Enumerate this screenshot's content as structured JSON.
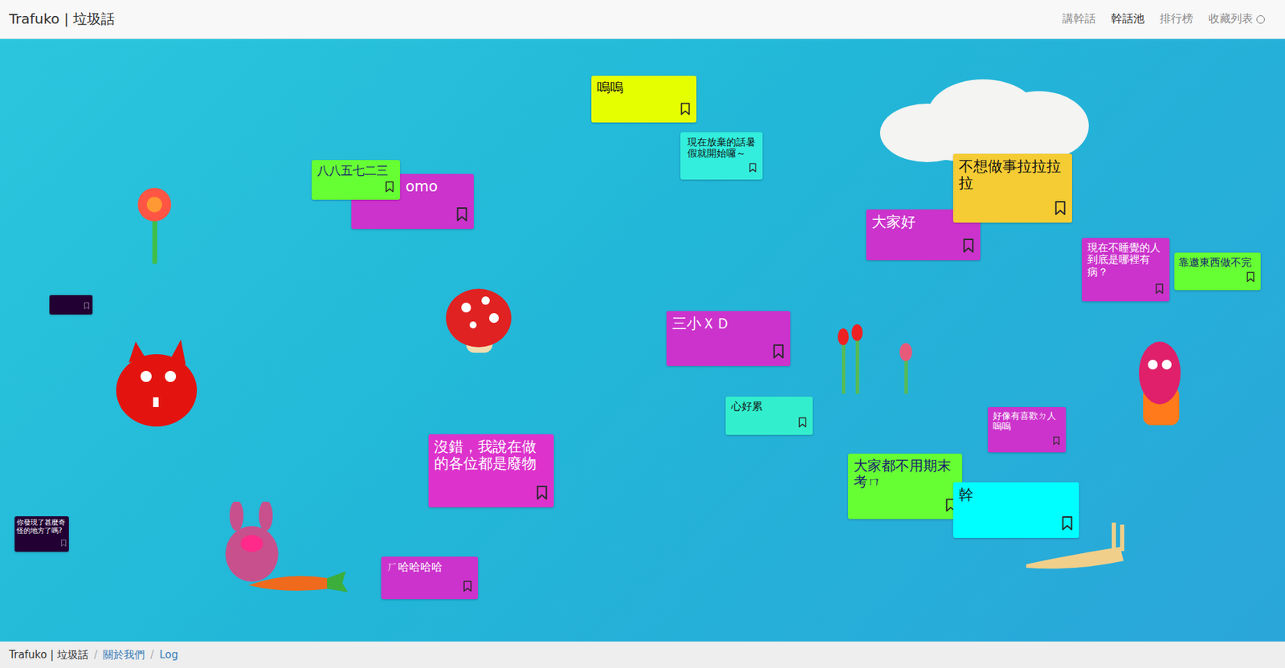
{
  "navbar": {
    "brand": "Trafuko | 垃圾話",
    "links": [
      {
        "label": "講幹話",
        "selected": false
      },
      {
        "label": "幹話池",
        "selected": true
      },
      {
        "label": "排行榜",
        "selected": false
      },
      {
        "label": "收藏列表",
        "selected": false
      }
    ]
  },
  "notes": [
    {
      "text": "嗚嗚",
      "color": "#e6ff00",
      "bookmarked": false
    },
    {
      "text": "現在放棄的話暑假就開始囉～",
      "color": "#33eedd",
      "bookmarked": false
    },
    {
      "text": "omo",
      "color": "#cc33cc",
      "bookmarked": false
    },
    {
      "text": "八八五七二三",
      "color": "#66ff33",
      "bookmarked": false
    },
    {
      "text": "大家好",
      "color": "#cc33cc",
      "bookmarked": false
    },
    {
      "text": "不想做事拉拉拉拉",
      "color": "#f5cc33",
      "bookmarked": false
    },
    {
      "text": "現在不睡覺的人到底是哪裡有病？",
      "color": "#cc33cc",
      "bookmarked": false
    },
    {
      "text": "靠邀東西做不完",
      "color": "#66ff33",
      "bookmarked": false
    },
    {
      "text": "",
      "color": "#220033",
      "bookmarked": false
    },
    {
      "text": "三小ＸＤ",
      "color": "#cc33cc",
      "bookmarked": false
    },
    {
      "text": "心好累",
      "color": "#33eecc",
      "bookmarked": false
    },
    {
      "text": "好像有喜歡ㄉ人嗚嗚",
      "color": "#cc33cc",
      "bookmarked": false
    },
    {
      "text": "沒錯，我說在做的各位都是廢物",
      "color": "#dd33cc",
      "bookmarked": false
    },
    {
      "text": "大家都不用期末考ㄇ",
      "color": "#66ff33",
      "bookmarked": false
    },
    {
      "text": "幹",
      "color": "#00ffff",
      "bookmarked": false
    },
    {
      "text": "ㄏ哈哈哈哈",
      "color": "#cc33cc",
      "bookmarked": false
    },
    {
      "text": "你發現了甚麼奇怪的地方了嗎?",
      "color": "#220033",
      "bookmarked": false
    }
  ],
  "footer": {
    "items": [
      {
        "text": "Trafuko | 垃圾話",
        "kind": "plain"
      },
      {
        "text": "/",
        "kind": "sep"
      },
      {
        "text": "關於我們",
        "kind": "link"
      },
      {
        "text": "/",
        "kind": "sep"
      },
      {
        "text": "Log",
        "kind": "link"
      }
    ]
  }
}
